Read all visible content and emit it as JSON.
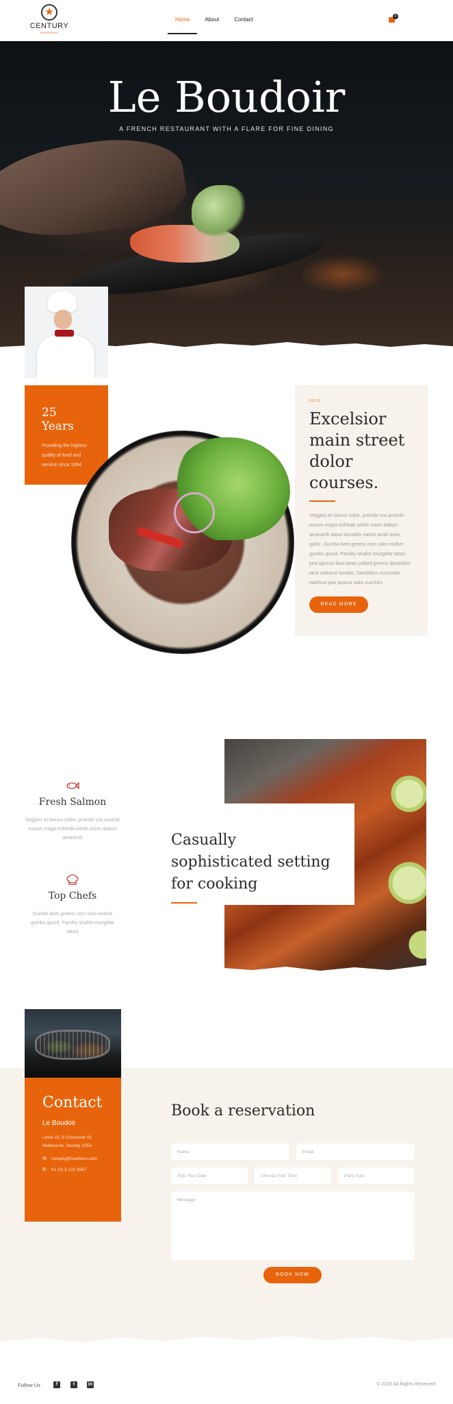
{
  "header": {
    "logo": {
      "brand": "CENTURY",
      "tagline": "RESTAURANT"
    },
    "nav": [
      {
        "label": "Home",
        "active": true
      },
      {
        "label": "About",
        "active": false
      },
      {
        "label": "Contact",
        "active": false
      }
    ],
    "cart_count": "0",
    "accent_color": "#e8640c"
  },
  "hero": {
    "title": "Le Boudoir",
    "subtitle": "A FRENCH RESTAURANT WITH A FLARE FOR FINE DINING"
  },
  "about": {
    "years_title": "25 Years",
    "years_text": "Providing the highest quality of food and service since 1954",
    "card": {
      "kicker": "01/11",
      "title": "Excelsior main street dolor courses.",
      "text": "Veggies es bonus vobis, proinde vos postulo essum magis kohlrabi welsh onion daikon amaranth tatsoi tomatillo melon azuki bean garlic. Gumbo beet greens corn soko endive gumbo gourd. Parsley shallot courgette tatsoi pea sprouts fava bean collard greens dandelion okra wakame tomato. Dandelion cucumber earthnut pea peanut soko zucchini.",
      "button": "READ MORE"
    }
  },
  "features": {
    "items": [
      {
        "icon": "fish-icon",
        "title": "Fresh Salmon",
        "text": "Veggies es bonus vobis, proinde vos postulo essum magis kohlrabi welsh onion daikon amaranth"
      },
      {
        "icon": "chef-hat-icon",
        "title": "Top Chefs",
        "text": "Gumbo beet greens corn soko endive gumbo gourd. Parsley shallot courgette tatsoi"
      }
    ],
    "highlight": "Casually sophisticated setting for cooking"
  },
  "contact": {
    "title": "Contact",
    "name": "Le Boudoir",
    "address": "Level 15, 6 Crossover St, Melbourne, Society 1054",
    "email": "noreply@nowhere.com",
    "phone": "61 (0) 3 123 4567"
  },
  "reservation": {
    "title": "Book a reservation",
    "fields": {
      "name": "Name",
      "email": "Email",
      "date": "Pick Your Date",
      "time": "Choose Your Time",
      "party": "Party Size",
      "message": "Message"
    },
    "button": "BOOK NOW"
  },
  "footer": {
    "follow": "Follow Us",
    "social": [
      "facebook-icon",
      "twitter-icon",
      "linkedin-icon"
    ],
    "copyright": "© 2020 All Rights Reserved"
  }
}
